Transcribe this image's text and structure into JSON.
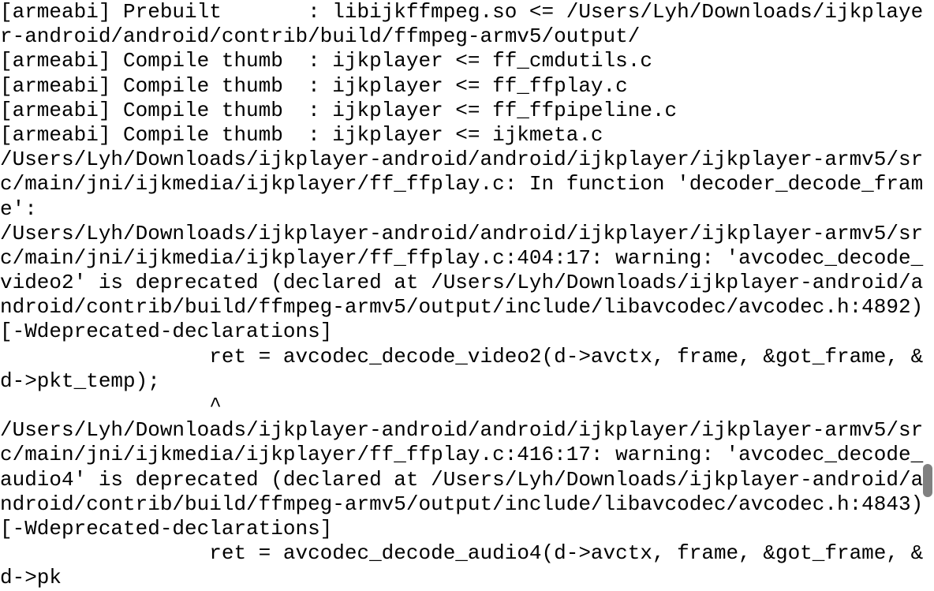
{
  "terminal": {
    "lines": [
      "[armeabi] Prebuilt       : libijkffmpeg.so <= /Users/Lyh/Downloads/ijkplayer-android/android/contrib/build/ffmpeg-armv5/output/",
      "[armeabi] Compile thumb  : ijkplayer <= ff_cmdutils.c",
      "[armeabi] Compile thumb  : ijkplayer <= ff_ffplay.c",
      "[armeabi] Compile thumb  : ijkplayer <= ff_ffpipeline.c",
      "[armeabi] Compile thumb  : ijkplayer <= ijkmeta.c",
      "/Users/Lyh/Downloads/ijkplayer-android/android/ijkplayer/ijkplayer-armv5/src/main/jni/ijkmedia/ijkplayer/ff_ffplay.c: In function 'decoder_decode_frame':",
      "/Users/Lyh/Downloads/ijkplayer-android/android/ijkplayer/ijkplayer-armv5/src/main/jni/ijkmedia/ijkplayer/ff_ffplay.c:404:17: warning: 'avcodec_decode_video2' is deprecated (declared at /Users/Lyh/Downloads/ijkplayer-android/android/contrib/build/ffmpeg-armv5/output/include/libavcodec/avcodec.h:4892) [-Wdeprecated-declarations]",
      "                 ret = avcodec_decode_video2(d->avctx, frame, &got_frame, &d->pkt_temp);",
      "                 ^",
      "/Users/Lyh/Downloads/ijkplayer-android/android/ijkplayer/ijkplayer-armv5/src/main/jni/ijkmedia/ijkplayer/ff_ffplay.c:416:17: warning: 'avcodec_decode_audio4' is deprecated (declared at /Users/Lyh/Downloads/ijkplayer-android/android/contrib/build/ffmpeg-armv5/output/include/libavcodec/avcodec.h:4843) [-Wdeprecated-declarations]",
      "                 ret = avcodec_decode_audio4(d->avctx, frame, &got_frame, &d->pk"
    ]
  }
}
